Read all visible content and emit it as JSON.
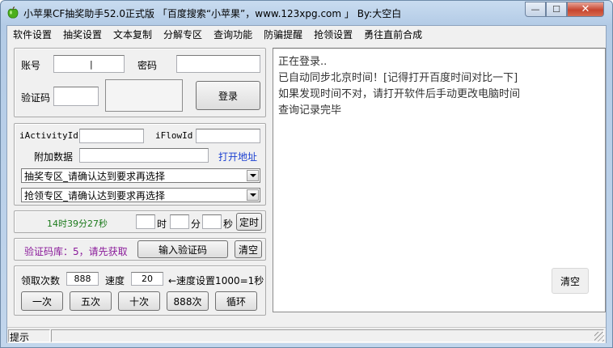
{
  "window": {
    "title": "小苹果CF抽奖助手52.0正式版 「百度搜索“小苹果”，www.123xpg.com 」 By:大空白",
    "close_symbol": "✕",
    "min_symbol": "—",
    "max_symbol": "☐"
  },
  "menu": [
    "软件设置",
    "抽奖设置",
    "文本复制",
    "分解专区",
    "查询功能",
    "防骗提醒",
    "抢领设置",
    "勇往直前合成"
  ],
  "login": {
    "account_label": "账号",
    "account_value": "|",
    "password_label": "密码",
    "password_value": "",
    "captcha_label": "验证码",
    "captcha_value": "",
    "login_button": "登录"
  },
  "activity": {
    "activity_id_label": "iActivityId",
    "activity_id_value": "",
    "flow_id_label": "iFlowId",
    "flow_id_value": "",
    "extra_label": "附加数据",
    "extra_value": "",
    "open_link": "打开地址",
    "lottery_select": "抽奖专区_请确认达到要求再选择",
    "grab_select": "抢领专区_请确认达到要求再选择"
  },
  "timer": {
    "clock": "14时39分27秒",
    "hour_label": "时",
    "minute_label": "分",
    "second_label": "秒",
    "hour_value": "",
    "minute_value": "",
    "second_value": "",
    "schedule_button": "定时"
  },
  "captcha_bank": {
    "status": "验证码库：5，请先获取",
    "input_button": "输入验证码",
    "clear_button": "清空"
  },
  "collect": {
    "count_label": "领取次数",
    "count_value": "888",
    "speed_label": "速度",
    "speed_value": "20",
    "speed_hint": "←速度设置1000=1秒",
    "once_button": "一次",
    "five_button": "五次",
    "ten_button": "十次",
    "eight_button": "888次",
    "loop_button": "循环"
  },
  "log": {
    "lines": [
      "正在登录..",
      "已自动同步北京时间！[记得打开百度时间对比一下]",
      "如果发现时间不对，请打开软件后手动更改电脑时间",
      "查询记录完毕"
    ],
    "clear_button": "清空"
  },
  "status": {
    "hint": "提示",
    "message": ""
  }
}
